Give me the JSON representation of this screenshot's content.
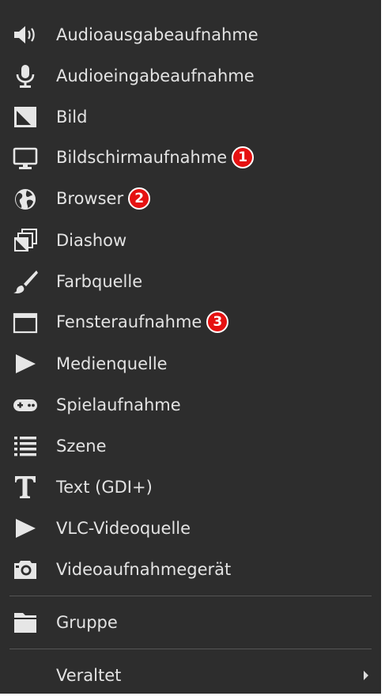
{
  "menu": {
    "items": [
      {
        "label": "Audioausgabeaufnahme",
        "icon": "speaker-icon"
      },
      {
        "label": "Audioeingabeaufnahme",
        "icon": "microphone-icon"
      },
      {
        "label": "Bild",
        "icon": "image-icon"
      },
      {
        "label": "Bildschirmaufnahme",
        "icon": "monitor-icon",
        "badge": "1"
      },
      {
        "label": "Browser",
        "icon": "globe-icon",
        "badge": "2"
      },
      {
        "label": "Diashow",
        "icon": "slideshow-icon"
      },
      {
        "label": "Farbquelle",
        "icon": "paintbrush-icon"
      },
      {
        "label": "Fensteraufnahme",
        "icon": "window-icon",
        "badge": "3"
      },
      {
        "label": "Medienquelle",
        "icon": "play-icon"
      },
      {
        "label": "Spielaufnahme",
        "icon": "gamepad-icon"
      },
      {
        "label": "Szene",
        "icon": "list-icon"
      },
      {
        "label": "Text (GDI+)",
        "icon": "text-icon"
      },
      {
        "label": "VLC-Videoquelle",
        "icon": "play-icon"
      },
      {
        "label": "Videoaufnahmegerät",
        "icon": "camera-icon"
      }
    ],
    "group": {
      "label": "Gruppe",
      "icon": "folder-icon"
    },
    "deprecated": {
      "label": "Veraltet",
      "icon": "submenu-arrow-icon"
    }
  },
  "colors": {
    "background": "#2d2d2d",
    "text": "#e3e3e3",
    "badge": "#e51212",
    "separator": "#555555"
  }
}
